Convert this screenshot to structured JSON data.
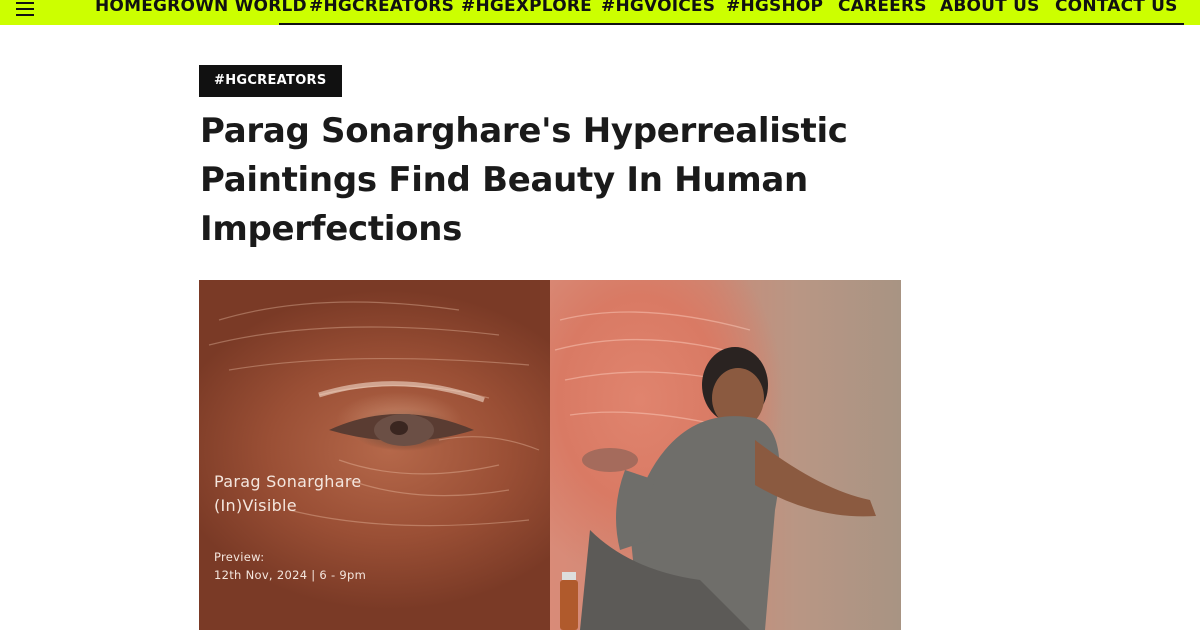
{
  "nav": {
    "menu_icon": "hamburger-menu-icon",
    "items": [
      {
        "label": "HOMEGROWN WORLD"
      },
      {
        "label": "#HGCREATORS"
      },
      {
        "label": "#HGEXPLORE"
      },
      {
        "label": "#HGVOICES"
      },
      {
        "label": "#HGSHOP"
      },
      {
        "label": "CAREERS"
      },
      {
        "label": "ABOUT US"
      },
      {
        "label": "CONTACT US"
      }
    ],
    "accent_color": "#ccff00"
  },
  "article": {
    "category_tag": "#HGCREATORS",
    "title": "Parag Sonarghare's Hyperrealistic Paintings Find Beauty In Human Imperfections",
    "hero": {
      "overlay_artist": "Parag Sonarghare",
      "overlay_show": "(In)Visible",
      "overlay_preview_label": "Preview:",
      "overlay_preview_date": "12th Nov, 2024 | 6 - 9pm"
    }
  }
}
